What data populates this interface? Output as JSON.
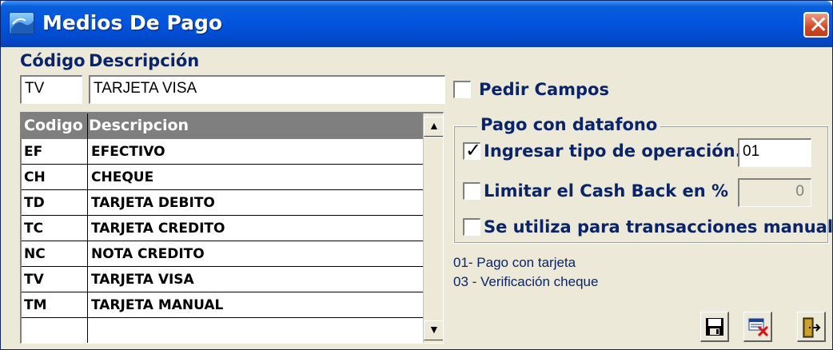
{
  "window": {
    "title": "Medios De Pago",
    "icon": "app-icon",
    "close_label": "✕"
  },
  "form": {
    "codigo_label": "Código",
    "descripcion_label": "Descripción",
    "codigo_value": "TV",
    "descripcion_value": "TARJETA VISA"
  },
  "pedir_campos": {
    "label": "Pedir Campos",
    "checked": false
  },
  "grid": {
    "columns": [
      "Codigo",
      "Descripcion"
    ],
    "rows": [
      {
        "code": "EF",
        "desc": "EFECTIVO"
      },
      {
        "code": "CH",
        "desc": "CHEQUE"
      },
      {
        "code": "TD",
        "desc": "TARJETA DEBITO"
      },
      {
        "code": "TC",
        "desc": "TARJETA CREDITO"
      },
      {
        "code": "NC",
        "desc": "NOTA CREDITO"
      },
      {
        "code": "TV",
        "desc": "TARJETA VISA"
      },
      {
        "code": "TM",
        "desc": "TARJETA MANUAL"
      },
      {
        "code": "",
        "desc": ""
      }
    ],
    "scroll_up": "▲",
    "scroll_down": "▼"
  },
  "datafono": {
    "title": "Pago con datafono",
    "ingresar_tipo": {
      "label": "Ingresar tipo de operación.",
      "checked": true,
      "check_mark": "✓",
      "value": "01"
    },
    "limitar_cash": {
      "label": "Limitar el Cash Back en %",
      "checked": false,
      "value": "0"
    },
    "manuales": {
      "label": "Se utiliza para transacciones manuales",
      "checked": false
    }
  },
  "notes": [
    "01- Pago con tarjeta",
    "03 - Verificación cheque"
  ],
  "toolbar": [
    "save-icon",
    "delete-icon",
    "exit-icon"
  ],
  "colors": {
    "title_bar": "#0355e0",
    "label_blue": "#0a246a",
    "window_bg": "#ece9d8",
    "grid_header": "#7f7f7f"
  }
}
